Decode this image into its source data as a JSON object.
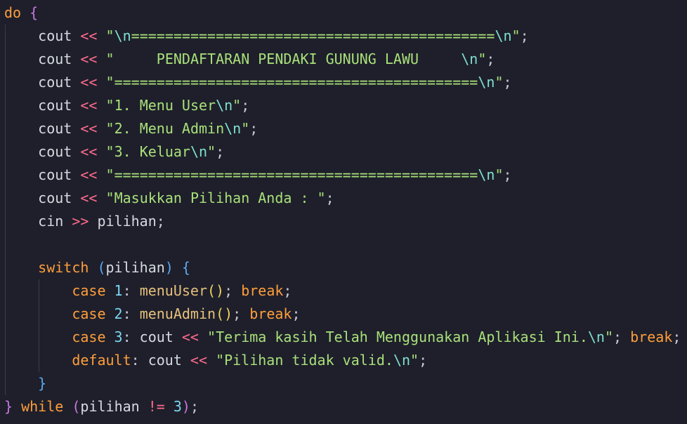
{
  "editor": {
    "lines": [
      {
        "indent": 0,
        "tokens": [
          [
            "kw",
            "do"
          ],
          [
            "plain",
            " "
          ],
          [
            "brace",
            "{"
          ]
        ]
      },
      {
        "indent": 1,
        "tokens": [
          [
            "plain",
            "cout "
          ],
          [
            "op",
            "<<"
          ],
          [
            "plain",
            " "
          ],
          [
            "str",
            "\""
          ],
          [
            "esc",
            "\\n"
          ],
          [
            "str",
            "==========================================="
          ],
          [
            "esc",
            "\\n"
          ],
          [
            "str",
            "\""
          ],
          [
            "punct",
            ";"
          ]
        ]
      },
      {
        "indent": 1,
        "tokens": [
          [
            "plain",
            "cout "
          ],
          [
            "op",
            "<<"
          ],
          [
            "plain",
            " "
          ],
          [
            "str",
            "\"     PENDAFTARAN PENDAKI GUNUNG LAWU     "
          ],
          [
            "esc",
            "\\n"
          ],
          [
            "str",
            "\""
          ],
          [
            "punct",
            ";"
          ]
        ]
      },
      {
        "indent": 1,
        "tokens": [
          [
            "plain",
            "cout "
          ],
          [
            "op",
            "<<"
          ],
          [
            "plain",
            " "
          ],
          [
            "str",
            "\"==========================================="
          ],
          [
            "esc",
            "\\n"
          ],
          [
            "str",
            "\""
          ],
          [
            "punct",
            ";"
          ]
        ]
      },
      {
        "indent": 1,
        "tokens": [
          [
            "plain",
            "cout "
          ],
          [
            "op",
            "<<"
          ],
          [
            "plain",
            " "
          ],
          [
            "str",
            "\"1. Menu User"
          ],
          [
            "esc",
            "\\n"
          ],
          [
            "str",
            "\""
          ],
          [
            "punct",
            ";"
          ]
        ]
      },
      {
        "indent": 1,
        "tokens": [
          [
            "plain",
            "cout "
          ],
          [
            "op",
            "<<"
          ],
          [
            "plain",
            " "
          ],
          [
            "str",
            "\"2. Menu Admin"
          ],
          [
            "esc",
            "\\n"
          ],
          [
            "str",
            "\""
          ],
          [
            "punct",
            ";"
          ]
        ]
      },
      {
        "indent": 1,
        "tokens": [
          [
            "plain",
            "cout "
          ],
          [
            "op",
            "<<"
          ],
          [
            "plain",
            " "
          ],
          [
            "str",
            "\"3. Keluar"
          ],
          [
            "esc",
            "\\n"
          ],
          [
            "str",
            "\""
          ],
          [
            "punct",
            ";"
          ]
        ]
      },
      {
        "indent": 1,
        "tokens": [
          [
            "plain",
            "cout "
          ],
          [
            "op",
            "<<"
          ],
          [
            "plain",
            " "
          ],
          [
            "str",
            "\"==========================================="
          ],
          [
            "esc",
            "\\n"
          ],
          [
            "str",
            "\""
          ],
          [
            "punct",
            ";"
          ]
        ]
      },
      {
        "indent": 1,
        "tokens": [
          [
            "plain",
            "cout "
          ],
          [
            "op",
            "<<"
          ],
          [
            "plain",
            " "
          ],
          [
            "str",
            "\"Masukkan Pilihan Anda : \""
          ],
          [
            "punct",
            ";"
          ]
        ]
      },
      {
        "indent": 1,
        "tokens": [
          [
            "plain",
            "cin "
          ],
          [
            "op",
            ">>"
          ],
          [
            "plain",
            " pilihan"
          ],
          [
            "punct",
            ";"
          ]
        ]
      },
      {
        "indent": 0,
        "tokens": []
      },
      {
        "indent": 1,
        "tokens": [
          [
            "kw",
            "switch"
          ],
          [
            "plain",
            " "
          ],
          [
            "paren",
            "("
          ],
          [
            "plain",
            "pilihan"
          ],
          [
            "paren",
            ")"
          ],
          [
            "plain",
            " "
          ],
          [
            "paren",
            "{"
          ]
        ]
      },
      {
        "indent": 2,
        "tokens": [
          [
            "kw",
            "case"
          ],
          [
            "plain",
            " "
          ],
          [
            "num",
            "1"
          ],
          [
            "punct",
            ":"
          ],
          [
            "plain",
            " "
          ],
          [
            "fn",
            "menuUser"
          ],
          [
            "yellow",
            "()"
          ],
          [
            "punct",
            ";"
          ],
          [
            "plain",
            " "
          ],
          [
            "kw",
            "break"
          ],
          [
            "punct",
            ";"
          ]
        ]
      },
      {
        "indent": 2,
        "tokens": [
          [
            "kw",
            "case"
          ],
          [
            "plain",
            " "
          ],
          [
            "num",
            "2"
          ],
          [
            "punct",
            ":"
          ],
          [
            "plain",
            " "
          ],
          [
            "fn",
            "menuAdmin"
          ],
          [
            "yellow",
            "()"
          ],
          [
            "punct",
            ";"
          ],
          [
            "plain",
            " "
          ],
          [
            "kw",
            "break"
          ],
          [
            "punct",
            ";"
          ]
        ]
      },
      {
        "indent": 2,
        "tokens": [
          [
            "kw",
            "case"
          ],
          [
            "plain",
            " "
          ],
          [
            "num",
            "3"
          ],
          [
            "punct",
            ":"
          ],
          [
            "plain",
            " cout "
          ],
          [
            "op",
            "<<"
          ],
          [
            "plain",
            " "
          ],
          [
            "str",
            "\"Terima kasih Telah Menggunakan Aplikasi Ini."
          ],
          [
            "esc",
            "\\n"
          ],
          [
            "str",
            "\""
          ],
          [
            "punct",
            ";"
          ],
          [
            "plain",
            " "
          ],
          [
            "kw",
            "break"
          ],
          [
            "punct",
            ";"
          ]
        ]
      },
      {
        "indent": 2,
        "tokens": [
          [
            "kw",
            "default"
          ],
          [
            "punct",
            ":"
          ],
          [
            "plain",
            " cout "
          ],
          [
            "op",
            "<<"
          ],
          [
            "plain",
            " "
          ],
          [
            "str",
            "\"Pilihan tidak valid."
          ],
          [
            "esc",
            "\\n"
          ],
          [
            "str",
            "\""
          ],
          [
            "punct",
            ";"
          ]
        ]
      },
      {
        "indent": 1,
        "tokens": [
          [
            "paren",
            "}"
          ]
        ]
      },
      {
        "indent": 0,
        "tokens": [
          [
            "brace",
            "}"
          ],
          [
            "plain",
            " "
          ],
          [
            "kw",
            "while"
          ],
          [
            "plain",
            " "
          ],
          [
            "brace",
            "("
          ],
          [
            "plain",
            "pilihan "
          ],
          [
            "op",
            "!="
          ],
          [
            "plain",
            " "
          ],
          [
            "num",
            "3"
          ],
          [
            "brace",
            ")"
          ],
          [
            "punct",
            ";"
          ]
        ]
      }
    ]
  },
  "colors": {
    "background": "#1e1f2b",
    "keyword": "#ff9e3b",
    "string": "#a9e07a",
    "escape": "#7fe0d0",
    "operator": "#ff6b8b"
  }
}
